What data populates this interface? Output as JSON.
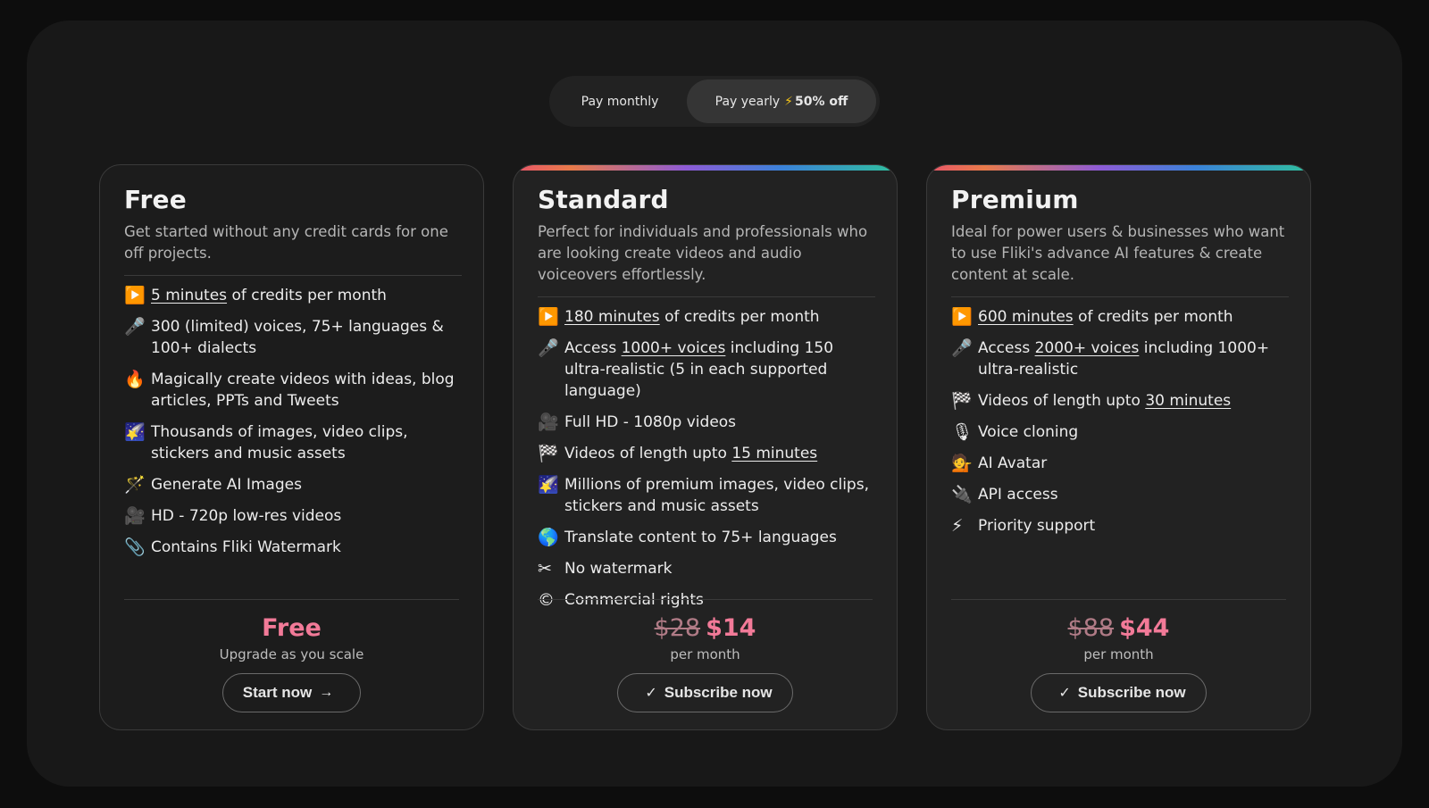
{
  "billing_toggle": {
    "monthly_label": "Pay monthly",
    "yearly_label": "Pay yearly",
    "yearly_discount": "50% off",
    "selected": "yearly"
  },
  "plans": [
    {
      "name": "Free",
      "description": "Get started without any credit cards for one off projects.",
      "features": [
        {
          "icon": "play-button-icon",
          "glyph": "▶️",
          "pre": "",
          "link": "5 minutes",
          "post": " of credits per month"
        },
        {
          "icon": "microphone-icon",
          "glyph": "🎤",
          "pre": "300 (limited) voices, 75+ languages & 100+ dialects",
          "link": "",
          "post": ""
        },
        {
          "icon": "fire-icon",
          "glyph": "🔥",
          "pre": "Magically create videos with ideas, blog articles, PPTs and Tweets",
          "link": "",
          "post": ""
        },
        {
          "icon": "picture-icon",
          "glyph": "🌠",
          "pre": "Thousands of images, video clips, stickers and music assets",
          "link": "",
          "post": ""
        },
        {
          "icon": "magic-wand-icon",
          "glyph": "🪄",
          "pre": "Generate AI Images",
          "link": "",
          "post": ""
        },
        {
          "icon": "video-camera-icon",
          "glyph": "🎥",
          "pre": "HD - 720p low-res videos",
          "link": "",
          "post": ""
        },
        {
          "icon": "paperclip-icon",
          "glyph": "📎",
          "pre": "Contains Fliki Watermark",
          "link": "",
          "post": ""
        }
      ],
      "price_old": "",
      "price": "Free",
      "period": "Upgrade as you scale",
      "cta": "Start now",
      "cta_icon": "arrow-right-icon"
    },
    {
      "name": "Standard",
      "description": "Perfect for individuals and professionals who are looking create videos and audio voiceovers effortlessly.",
      "features": [
        {
          "icon": "play-button-icon",
          "glyph": "▶️",
          "pre": "",
          "link": "180 minutes",
          "post": " of credits per month"
        },
        {
          "icon": "microphone-icon",
          "glyph": "🎤",
          "pre": "Access ",
          "link": "1000+ voices",
          "post": " including 150 ultra-realistic (5 in each supported language)"
        },
        {
          "icon": "video-camera-icon",
          "glyph": "🎥",
          "pre": "Full HD - 1080p videos",
          "link": "",
          "post": ""
        },
        {
          "icon": "checkered-flag-icon",
          "glyph": "🏁",
          "pre": "Videos of length upto ",
          "link": "15 minutes",
          "post": ""
        },
        {
          "icon": "picture-icon",
          "glyph": "🌠",
          "pre": "Millions of premium images, video clips, stickers and music assets",
          "link": "",
          "post": ""
        },
        {
          "icon": "globe-icon",
          "glyph": "🌎",
          "pre": "Translate content to 75+ languages",
          "link": "",
          "post": ""
        },
        {
          "icon": "scissors-icon",
          "glyph": "✂",
          "pre": "No watermark",
          "link": "",
          "post": ""
        },
        {
          "icon": "copyright-icon",
          "glyph": "©",
          "pre": "Commercial rights",
          "link": "",
          "post": ""
        }
      ],
      "price_old": "$28",
      "price": "$14",
      "period": "per month",
      "cta": "Subscribe now",
      "cta_icon": "check-icon"
    },
    {
      "name": "Premium",
      "description": "Ideal for power users & businesses who want to use Fliki's advance AI features & create content at scale.",
      "features": [
        {
          "icon": "play-button-icon",
          "glyph": "▶️",
          "pre": "",
          "link": "600 minutes",
          "post": " of credits per month"
        },
        {
          "icon": "microphone-icon",
          "glyph": "🎤",
          "pre": "Access ",
          "link": "2000+ voices",
          "post": " including 1000+ ultra-realistic"
        },
        {
          "icon": "checkered-flag-icon",
          "glyph": "🏁",
          "pre": "Videos of length upto ",
          "link": "30 minutes",
          "post": ""
        },
        {
          "icon": "studio-microphone-icon",
          "glyph": "🎙",
          "pre": "Voice cloning",
          "link": "",
          "post": ""
        },
        {
          "icon": "person-avatar-icon",
          "glyph": "💁",
          "pre": "AI Avatar",
          "link": "",
          "post": ""
        },
        {
          "icon": "electric-plug-icon",
          "glyph": "🔌",
          "pre": "API access",
          "link": "",
          "post": ""
        },
        {
          "icon": "lightning-icon",
          "glyph": "⚡",
          "pre": "Priority support",
          "link": "",
          "post": ""
        }
      ],
      "price_old": "$88",
      "price": "$44",
      "period": "per month",
      "cta": "Subscribe now",
      "cta_icon": "check-icon"
    }
  ]
}
